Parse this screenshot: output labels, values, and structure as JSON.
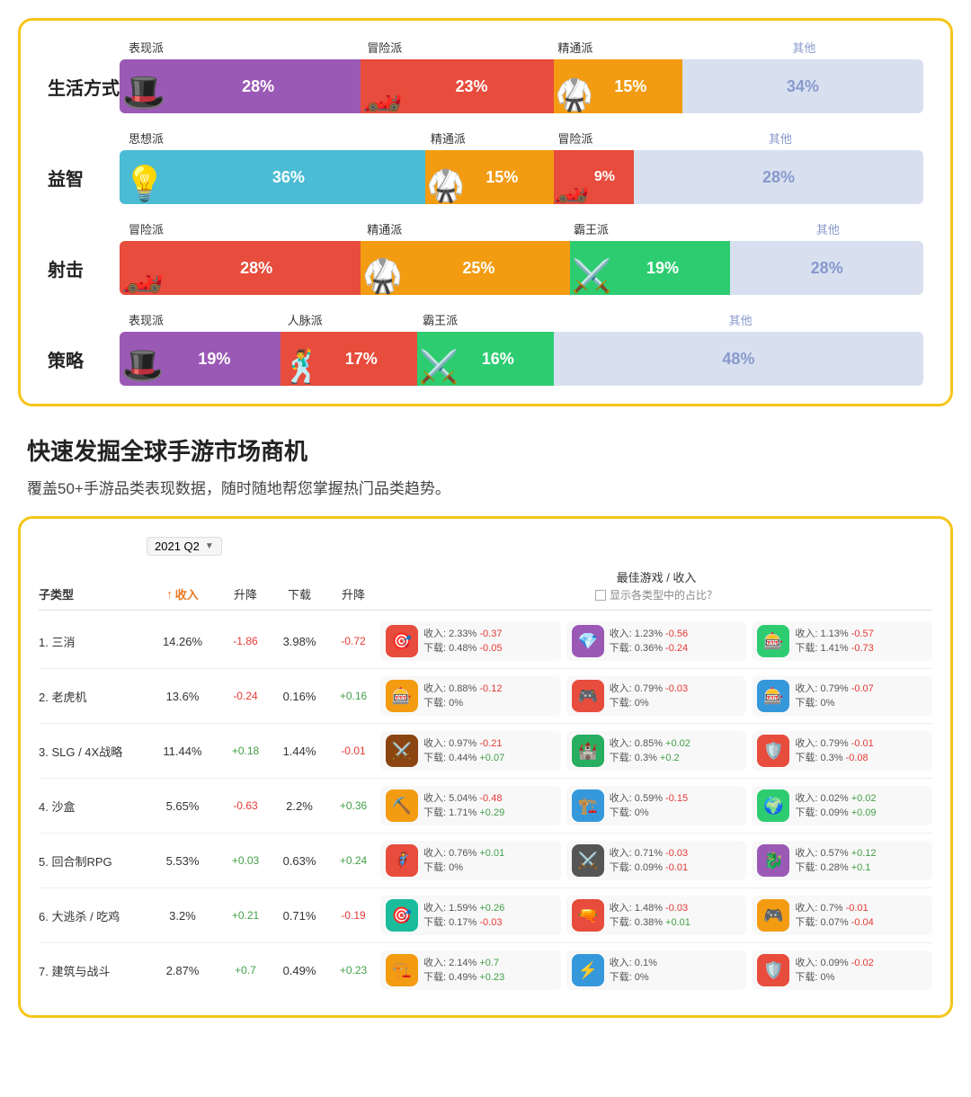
{
  "topCard": {
    "genres": [
      {
        "name": "生活方式",
        "labels": [
          {
            "text": "表现派",
            "x": "5%"
          },
          {
            "text": "冒险派",
            "x": "32%"
          },
          {
            "text": "精通派",
            "x": "58%"
          },
          {
            "text": "其他",
            "x": "80%",
            "isOther": true
          }
        ],
        "segments": [
          {
            "label": "28%",
            "width": "30%",
            "color": "#9B59B6"
          },
          {
            "label": "23%",
            "width": "24%",
            "color": "#E74C3C"
          },
          {
            "label": "15%",
            "width": "16%",
            "color": "#F39C12"
          },
          {
            "label": "34%",
            "width": "30%",
            "color": "#D8E0F0",
            "isOther": true
          }
        ],
        "chars": [
          "🎩",
          "🏎️",
          "🥋"
        ]
      },
      {
        "name": "益智",
        "labels": [
          {
            "text": "思想派",
            "x": "5%"
          },
          {
            "text": "精通派",
            "x": "50%"
          },
          {
            "text": "冒险派",
            "x": "66%"
          },
          {
            "text": "其他",
            "x": "80%",
            "isOther": true
          }
        ],
        "segments": [
          {
            "label": "36%",
            "width": "38%",
            "color": "#4ABCD4"
          },
          {
            "label": "15%",
            "width": "16%",
            "color": "#F39C12"
          },
          {
            "label": "9%",
            "width": "10%",
            "color": "#E74C3C"
          },
          {
            "label": "28%",
            "width": "30%",
            "color": "#D8E0F0",
            "isOther": true
          }
        ],
        "chars": [
          "💡",
          "🥋",
          "🏎️"
        ]
      },
      {
        "name": "射击",
        "labels": [
          {
            "text": "冒险派",
            "x": "5%"
          },
          {
            "text": "精通派",
            "x": "35%"
          },
          {
            "text": "霸王派",
            "x": "60%"
          },
          {
            "text": "其他",
            "x": "80%",
            "isOther": true
          }
        ],
        "segments": [
          {
            "label": "28%",
            "width": "30%",
            "color": "#E74C3C"
          },
          {
            "label": "25%",
            "width": "26%",
            "color": "#F39C12"
          },
          {
            "label": "19%",
            "width": "20%",
            "color": "#2ECC71"
          },
          {
            "label": "28%",
            "width": "24%",
            "color": "#D8E0F0",
            "isOther": true
          }
        ],
        "chars": [
          "🏎️",
          "🥋",
          "⚔️"
        ]
      },
      {
        "name": "策略",
        "labels": [
          {
            "text": "表现派",
            "x": "3%"
          },
          {
            "text": "人脉派",
            "x": "22%"
          },
          {
            "text": "霸王派",
            "x": "38%"
          },
          {
            "text": "其他",
            "x": "70%",
            "isOther": true
          }
        ],
        "segments": [
          {
            "label": "19%",
            "width": "20%",
            "color": "#9B59B6"
          },
          {
            "label": "17%",
            "width": "17%",
            "color": "#E74C3C"
          },
          {
            "label": "16%",
            "width": "17%",
            "color": "#2ECC71"
          },
          {
            "label": "48%",
            "width": "46%",
            "color": "#D8E0F0",
            "isOther": true
          }
        ],
        "chars": [
          "🎩",
          "🕺",
          "⚔️"
        ]
      }
    ]
  },
  "sectionHeading": "快速发掘全球手游市场商机",
  "sectionSubtext": "覆盖50+手游品类表现数据，随时随地帮您掌握热门品类趋势。",
  "tableCard": {
    "quarterLabel": "2021 Q2",
    "bestGameHeader": "最佳游戏 / 收入",
    "showShareLabel": "显示各类型中的占比？",
    "headers": {
      "subtype": "子类型",
      "revenue": "收入",
      "revChange": "升降",
      "download": "下载",
      "dlChange": "升降"
    },
    "revenueIcon": "↑",
    "rows": [
      {
        "rank": "1",
        "name": "三消",
        "revenue": "14.26%",
        "revChange": "-1.86",
        "revChangeType": "down",
        "download": "3.98%",
        "dlChange": "-0.72",
        "dlChangeType": "down",
        "games": [
          {
            "icon": "🎯",
            "iconBg": "#E74C3C",
            "stats": "收入: 2.33% -0.37\n下载: 0.48% -0.05"
          },
          {
            "icon": "💎",
            "iconBg": "#9B59B6",
            "stats": "收入: 1.23% -0.56\n下载: 0.36% -0.24"
          },
          {
            "icon": "🎰",
            "iconBg": "#2ECC71",
            "stats": "收入: 1.13% -0.57\n下载: 1.41% -0.73"
          }
        ]
      },
      {
        "rank": "2",
        "name": "老虎机",
        "revenue": "13.6%",
        "revChange": "-0.24",
        "revChangeType": "down",
        "download": "0.16%",
        "dlChange": "+0.16",
        "dlChangeType": "up",
        "games": [
          {
            "icon": "🎰",
            "iconBg": "#F39C12",
            "stats": "收入: 0.88% -0.12\n下载: 0%"
          },
          {
            "icon": "🎮",
            "iconBg": "#E74C3C",
            "stats": "收入: 0.79% -0.03\n下载: 0%"
          },
          {
            "icon": "🎰",
            "iconBg": "#3498DB",
            "stats": "收入: 0.79% -0.07\n下载: 0%"
          }
        ]
      },
      {
        "rank": "3",
        "name": "SLG / 4X战略",
        "revenue": "11.44%",
        "revChange": "+0.18",
        "revChangeType": "up",
        "download": "1.44%",
        "dlChange": "-0.01",
        "dlChangeType": "down",
        "games": [
          {
            "icon": "⚔️",
            "iconBg": "#8B4513",
            "stats": "收入: 0.97% -0.21\n下载: 0.44% +0.07"
          },
          {
            "icon": "🏰",
            "iconBg": "#27AE60",
            "stats": "收入: 0.85% +0.02\n下载: 0.3% +0.2"
          },
          {
            "icon": "🛡️",
            "iconBg": "#E74C3C",
            "stats": "收入: 0.79% -0.01\n下载: 0.3% -0.08"
          }
        ]
      },
      {
        "rank": "4",
        "name": "沙盒",
        "revenue": "5.65%",
        "revChange": "-0.63",
        "revChangeType": "down",
        "download": "2.2%",
        "dlChange": "+0.36",
        "dlChangeType": "up",
        "games": [
          {
            "icon": "⛏️",
            "iconBg": "#F39C12",
            "stats": "收入: 5.04% -0.48\n下载: 1.71% +0.29"
          },
          {
            "icon": "🏗️",
            "iconBg": "#3498DB",
            "stats": "收入: 0.59% -0.15\n下载: 0%"
          },
          {
            "icon": "🌍",
            "iconBg": "#2ECC71",
            "stats": "收入: 0.02% +0.02\n下载: 0.09% +0.09"
          }
        ]
      },
      {
        "rank": "5",
        "name": "回合制RPG",
        "revenue": "5.53%",
        "revChange": "+0.03",
        "revChangeType": "up",
        "download": "0.63%",
        "dlChange": "+0.24",
        "dlChangeType": "up",
        "games": [
          {
            "icon": "🦸",
            "iconBg": "#E74C3C",
            "stats": "收入: 0.76% +0.01\n下载: 0%"
          },
          {
            "icon": "⚔️",
            "iconBg": "#555",
            "stats": "收入: 0.71% -0.03\n下载: 0.09% -0.01"
          },
          {
            "icon": "🐉",
            "iconBg": "#9B59B6",
            "stats": "收入: 0.57% +0.12\n下载: 0.28% +0.1"
          }
        ]
      },
      {
        "rank": "6",
        "name": "大逃杀 / 吃鸡",
        "revenue": "3.2%",
        "revChange": "+0.21",
        "revChangeType": "up",
        "download": "0.71%",
        "dlChange": "-0.19",
        "dlChangeType": "down",
        "games": [
          {
            "icon": "🎯",
            "iconBg": "#1ABC9C",
            "stats": "收入: 1.59% +0.26\n下载: 0.17% -0.03"
          },
          {
            "icon": "🔫",
            "iconBg": "#E74C3C",
            "stats": "收入: 1.48% -0.03\n下载: 0.38% +0.01"
          },
          {
            "icon": "🎮",
            "iconBg": "#F39C12",
            "stats": "收入: 0.7% -0.01\n下载: 0.07% -0.04"
          }
        ]
      },
      {
        "rank": "7",
        "name": "建筑与战斗",
        "revenue": "2.87%",
        "revChange": "+0.7",
        "revChangeType": "up",
        "download": "0.49%",
        "dlChange": "+0.23",
        "dlChangeType": "up",
        "games": [
          {
            "icon": "🏗️",
            "iconBg": "#F39C12",
            "stats": "收入: 2.14% +0.7\n下载: 0.49% +0.23"
          },
          {
            "icon": "⚡",
            "iconBg": "#3498DB",
            "stats": "收入: 0.1%\n下载: 0%"
          },
          {
            "icon": "🛡️",
            "iconBg": "#E74C3C",
            "stats": "收入: 0.09% -0.02\n下载: 0%"
          }
        ]
      }
    ]
  }
}
